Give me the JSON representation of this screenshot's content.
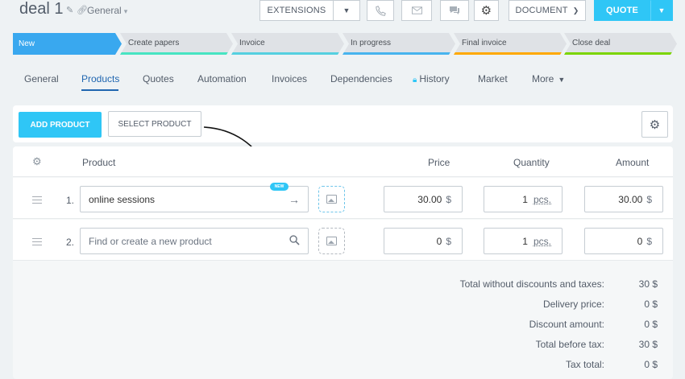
{
  "header": {
    "title": "deal 1",
    "pipeline": "General",
    "buttons": {
      "extensions": "EXTENSIONS",
      "document": "DOCUMENT",
      "quote": "QUOTE"
    }
  },
  "stages": [
    {
      "label": "New",
      "active": true,
      "color": "#39a8ef"
    },
    {
      "label": "Create papers",
      "color": "#47e4c2"
    },
    {
      "label": "Invoice",
      "color": "#55d0e0"
    },
    {
      "label": "In progress",
      "color": "#47b4ee"
    },
    {
      "label": "Final invoice",
      "color": "#ffa900"
    },
    {
      "label": "Close deal",
      "color": "#7bd500"
    }
  ],
  "tabs": [
    "General",
    "Products",
    "Quotes",
    "Automation",
    "Invoices",
    "Dependencies",
    "History",
    "Market",
    "More"
  ],
  "active_tab": "Products",
  "toolbar": {
    "add_product": "ADD PRODUCT",
    "select_product": "SELECT PRODUCT"
  },
  "table": {
    "columns": {
      "product": "Product",
      "price": "Price",
      "quantity": "Quantity",
      "amount": "Amount"
    },
    "rows": [
      {
        "num": "1.",
        "product": "online sessions",
        "badge": "NEW",
        "price": "30.00",
        "currency": "$",
        "quantity": "1",
        "unit": "pcs.",
        "amount": "30.00"
      },
      {
        "num": "2.",
        "product_placeholder": "Find or create a new product",
        "price": "0",
        "currency": "$",
        "quantity": "1",
        "unit": "pcs.",
        "amount": "0"
      }
    ]
  },
  "totals": [
    {
      "label": "Total without discounts and taxes:",
      "value": "30 $"
    },
    {
      "label": "Delivery price:",
      "value": "0 $"
    },
    {
      "label": "Discount amount:",
      "value": "0 $"
    },
    {
      "label": "Total before tax:",
      "value": "30 $"
    },
    {
      "label": "Tax total:",
      "value": "0 $"
    }
  ],
  "colors": {
    "accent": "#2fc6f6",
    "active_tab": "#2066b0",
    "stage_new": "#39a8ef"
  }
}
